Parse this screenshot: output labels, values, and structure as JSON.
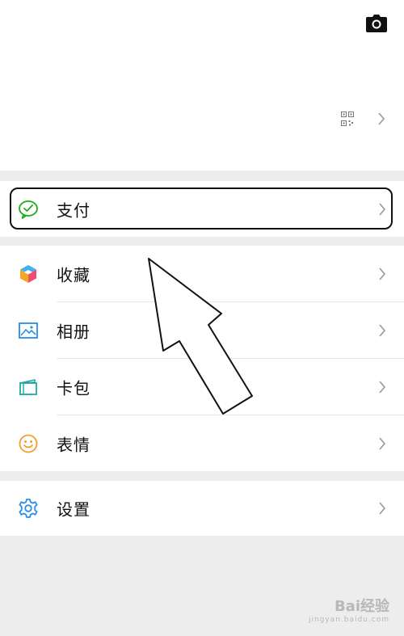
{
  "menu": {
    "pay": {
      "label": "支付",
      "icon": "wechat-pay-icon"
    },
    "items": [
      {
        "label": "收藏",
        "icon": "favorites-cube-icon"
      },
      {
        "label": "相册",
        "icon": "album-picture-icon"
      },
      {
        "label": "卡包",
        "icon": "card-wallet-icon"
      },
      {
        "label": "表情",
        "icon": "smiley-face-icon"
      }
    ],
    "settings": {
      "label": "设置",
      "icon": "gear-icon"
    }
  },
  "watermark": {
    "brand": "Bai经验",
    "url": "jingyan.baidu.com"
  },
  "colors": {
    "accent_green": "#1aad19",
    "background": "#ededed"
  }
}
